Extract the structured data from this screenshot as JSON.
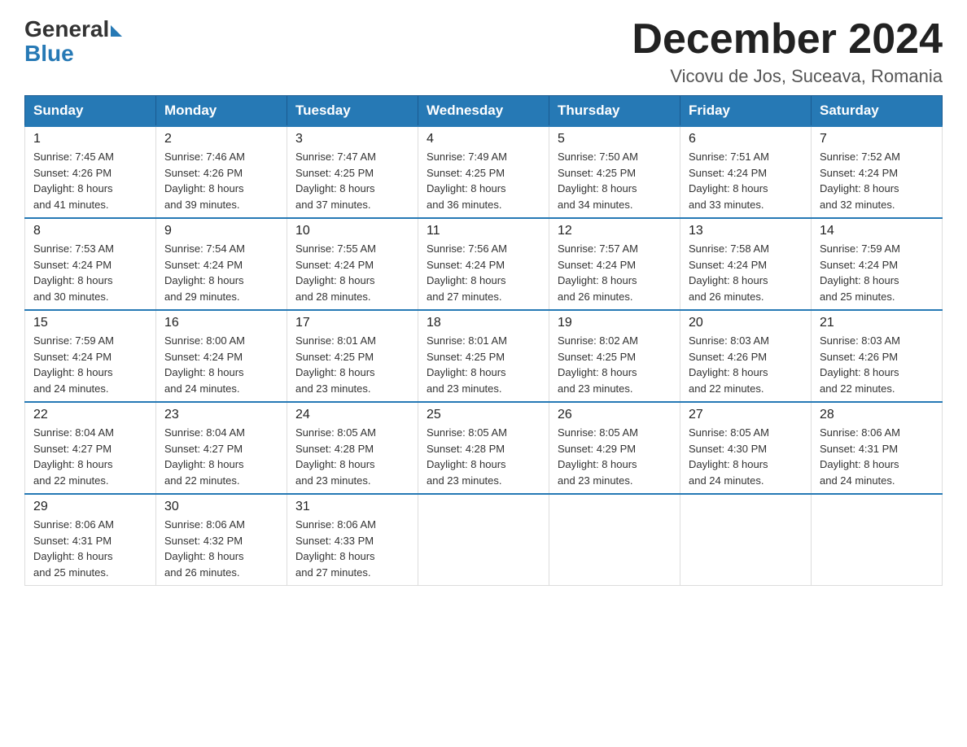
{
  "logo": {
    "general": "General",
    "blue": "Blue",
    "arrow": "▶"
  },
  "title": "December 2024",
  "subtitle": "Vicovu de Jos, Suceava, Romania",
  "headers": [
    "Sunday",
    "Monday",
    "Tuesday",
    "Wednesday",
    "Thursday",
    "Friday",
    "Saturday"
  ],
  "weeks": [
    [
      {
        "day": "1",
        "sunrise": "7:45 AM",
        "sunset": "4:26 PM",
        "daylight": "8 hours and 41 minutes."
      },
      {
        "day": "2",
        "sunrise": "7:46 AM",
        "sunset": "4:26 PM",
        "daylight": "8 hours and 39 minutes."
      },
      {
        "day": "3",
        "sunrise": "7:47 AM",
        "sunset": "4:25 PM",
        "daylight": "8 hours and 37 minutes."
      },
      {
        "day": "4",
        "sunrise": "7:49 AM",
        "sunset": "4:25 PM",
        "daylight": "8 hours and 36 minutes."
      },
      {
        "day": "5",
        "sunrise": "7:50 AM",
        "sunset": "4:25 PM",
        "daylight": "8 hours and 34 minutes."
      },
      {
        "day": "6",
        "sunrise": "7:51 AM",
        "sunset": "4:24 PM",
        "daylight": "8 hours and 33 minutes."
      },
      {
        "day": "7",
        "sunrise": "7:52 AM",
        "sunset": "4:24 PM",
        "daylight": "8 hours and 32 minutes."
      }
    ],
    [
      {
        "day": "8",
        "sunrise": "7:53 AM",
        "sunset": "4:24 PM",
        "daylight": "8 hours and 30 minutes."
      },
      {
        "day": "9",
        "sunrise": "7:54 AM",
        "sunset": "4:24 PM",
        "daylight": "8 hours and 29 minutes."
      },
      {
        "day": "10",
        "sunrise": "7:55 AM",
        "sunset": "4:24 PM",
        "daylight": "8 hours and 28 minutes."
      },
      {
        "day": "11",
        "sunrise": "7:56 AM",
        "sunset": "4:24 PM",
        "daylight": "8 hours and 27 minutes."
      },
      {
        "day": "12",
        "sunrise": "7:57 AM",
        "sunset": "4:24 PM",
        "daylight": "8 hours and 26 minutes."
      },
      {
        "day": "13",
        "sunrise": "7:58 AM",
        "sunset": "4:24 PM",
        "daylight": "8 hours and 26 minutes."
      },
      {
        "day": "14",
        "sunrise": "7:59 AM",
        "sunset": "4:24 PM",
        "daylight": "8 hours and 25 minutes."
      }
    ],
    [
      {
        "day": "15",
        "sunrise": "7:59 AM",
        "sunset": "4:24 PM",
        "daylight": "8 hours and 24 minutes."
      },
      {
        "day": "16",
        "sunrise": "8:00 AM",
        "sunset": "4:24 PM",
        "daylight": "8 hours and 24 minutes."
      },
      {
        "day": "17",
        "sunrise": "8:01 AM",
        "sunset": "4:25 PM",
        "daylight": "8 hours and 23 minutes."
      },
      {
        "day": "18",
        "sunrise": "8:01 AM",
        "sunset": "4:25 PM",
        "daylight": "8 hours and 23 minutes."
      },
      {
        "day": "19",
        "sunrise": "8:02 AM",
        "sunset": "4:25 PM",
        "daylight": "8 hours and 23 minutes."
      },
      {
        "day": "20",
        "sunrise": "8:03 AM",
        "sunset": "4:26 PM",
        "daylight": "8 hours and 22 minutes."
      },
      {
        "day": "21",
        "sunrise": "8:03 AM",
        "sunset": "4:26 PM",
        "daylight": "8 hours and 22 minutes."
      }
    ],
    [
      {
        "day": "22",
        "sunrise": "8:04 AM",
        "sunset": "4:27 PM",
        "daylight": "8 hours and 22 minutes."
      },
      {
        "day": "23",
        "sunrise": "8:04 AM",
        "sunset": "4:27 PM",
        "daylight": "8 hours and 22 minutes."
      },
      {
        "day": "24",
        "sunrise": "8:05 AM",
        "sunset": "4:28 PM",
        "daylight": "8 hours and 23 minutes."
      },
      {
        "day": "25",
        "sunrise": "8:05 AM",
        "sunset": "4:28 PM",
        "daylight": "8 hours and 23 minutes."
      },
      {
        "day": "26",
        "sunrise": "8:05 AM",
        "sunset": "4:29 PM",
        "daylight": "8 hours and 23 minutes."
      },
      {
        "day": "27",
        "sunrise": "8:05 AM",
        "sunset": "4:30 PM",
        "daylight": "8 hours and 24 minutes."
      },
      {
        "day": "28",
        "sunrise": "8:06 AM",
        "sunset": "4:31 PM",
        "daylight": "8 hours and 24 minutes."
      }
    ],
    [
      {
        "day": "29",
        "sunrise": "8:06 AM",
        "sunset": "4:31 PM",
        "daylight": "8 hours and 25 minutes."
      },
      {
        "day": "30",
        "sunrise": "8:06 AM",
        "sunset": "4:32 PM",
        "daylight": "8 hours and 26 minutes."
      },
      {
        "day": "31",
        "sunrise": "8:06 AM",
        "sunset": "4:33 PM",
        "daylight": "8 hours and 27 minutes."
      },
      null,
      null,
      null,
      null
    ]
  ],
  "labels": {
    "sunrise": "Sunrise: ",
    "sunset": "Sunset: ",
    "daylight": "Daylight: "
  }
}
